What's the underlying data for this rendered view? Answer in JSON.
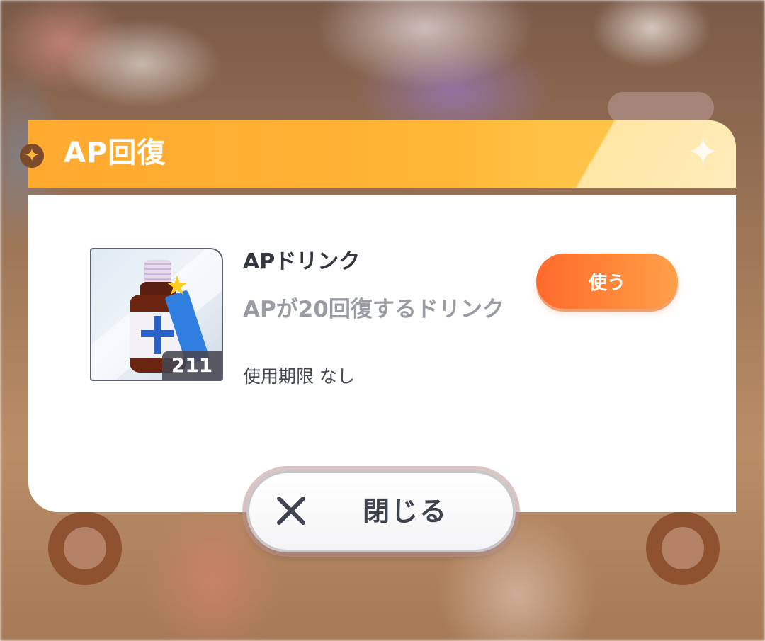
{
  "dialog": {
    "title": "AP回復",
    "close_label": "閉じる"
  },
  "item": {
    "name": "APドリンク",
    "description": "APが20回復するドリンク",
    "expiry": "使用期限 なし",
    "count": "211",
    "use_label": "使う",
    "icon": "energy-drink-bottle-icon"
  },
  "colors": {
    "header_orange": "#ffb637",
    "use_button": "#ff7a33",
    "desc_gray": "#9a9ca3",
    "text_dark": "#333740"
  }
}
